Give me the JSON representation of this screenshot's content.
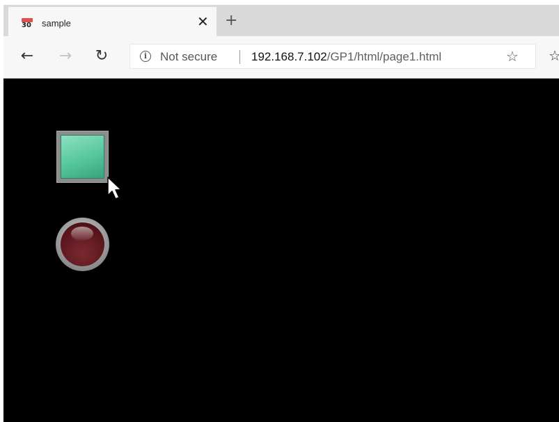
{
  "browser": {
    "tab": {
      "favicon_top": "RGB",
      "favicon_number": "30",
      "title": "sample",
      "close_glyph": "✕"
    },
    "new_tab_glyph": "+",
    "nav": {
      "back_icon": "←",
      "forward_icon": "→",
      "refresh_icon": "↻"
    },
    "address_bar": {
      "security_label": "Not secure",
      "url_host": "192.168.7.102",
      "url_path": "/GP1/html/page1.html",
      "favorite_icon": "☆",
      "favorites_icon": "☆"
    }
  },
  "page": {
    "background_color": "#000000",
    "square_button": {
      "icon": "square-button",
      "color": "#55c79c"
    },
    "lamp": {
      "icon": "lamp",
      "state": "off",
      "color": "#5b171d"
    }
  }
}
